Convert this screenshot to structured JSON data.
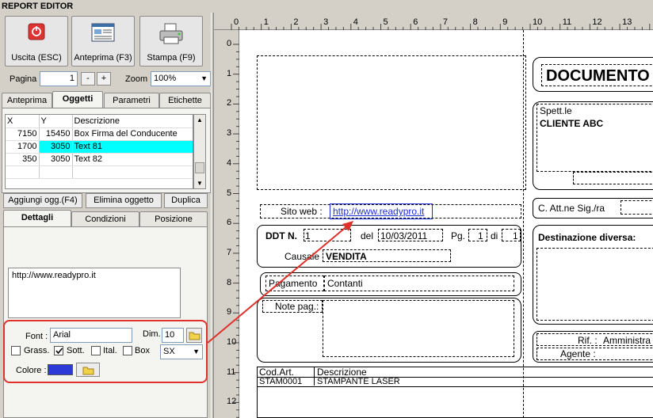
{
  "window": {
    "title": "REPORT EDITOR"
  },
  "toolbar": {
    "exit_label": "Uscita (ESC)",
    "preview_label": "Anteprima (F3)",
    "print_label": "Stampa (F9)"
  },
  "nav": {
    "page_label": "Pagina",
    "page_value": "1",
    "minus": "-",
    "plus": "+",
    "zoom_label": "Zoom",
    "zoom_value": "100%"
  },
  "tabs_top": [
    "Anteprima",
    "Oggetti",
    "Parametri",
    "Etichette"
  ],
  "objects_table": {
    "headers": [
      "X",
      "Y",
      "Descrizione"
    ],
    "rows": [
      [
        "7150",
        "15450",
        "Box Firma del Conducente"
      ],
      [
        "1700",
        "3050",
        "Text 81"
      ],
      [
        "350",
        "3050",
        "Text 82"
      ]
    ]
  },
  "actions": {
    "add_label": "Aggiungi ogg.(F4)",
    "delete_label": "Elimina oggetto",
    "duplicate_label": "Duplica"
  },
  "tabs_details": [
    "Dettagli",
    "Condizioni",
    "Posizione"
  ],
  "details": {
    "text_value": "http://www.readypro.it",
    "font_label": "Font :",
    "font_value": "Arial",
    "dim_label": "Dim.",
    "dim_value": "10",
    "bold_label": "Grass.",
    "underline_label": "Sott.",
    "italic_label": "Ital.",
    "box_label": "Box",
    "align_value": "SX",
    "color_label": "Colore :",
    "color_value": "#2c3bd8"
  },
  "ruler": {
    "top": [
      "0",
      "1",
      "2",
      "3",
      "4",
      "5",
      "6",
      "7",
      "8",
      "9",
      "10",
      "11",
      "12",
      "13"
    ],
    "left": [
      "0",
      "1",
      "2",
      "3",
      "4",
      "5",
      "6",
      "7",
      "8",
      "9",
      "10",
      "11",
      "12"
    ]
  },
  "report": {
    "doc_title": "DOCUMENTO",
    "spett_label": "Spett.le",
    "client_name": "CLIENTE ABC",
    "sito_label": "Sito web :",
    "sito_value": "http://www.readypro.it",
    "att_label": "C. Att.ne Sig./ra",
    "ddt_label": "DDT N.",
    "ddt_number": "1",
    "del_label": "del",
    "ddt_date": "10/03/2011",
    "pg_label": "Pg.",
    "pg_num": "1",
    "di_label": "di",
    "pg_total": "1",
    "causale_label": "Causale",
    "causale_value": "VENDITA",
    "dest_label": "Destinazione diversa:",
    "pagamento_label": "Pagamento",
    "pagamento_value": "Contanti",
    "note_label": "Note pag.:",
    "rif_label": "Rif. :",
    "rif_value": "Amministra",
    "agente_label": "Agente :",
    "col_code": "Cod.Art.",
    "col_desc": "Descrizione",
    "row_code": "STAM0001",
    "row_desc": "STAMPANTE LASER"
  },
  "colors": {
    "highlight_row": "#00ffff",
    "annotation": "#e0302a",
    "link": "#1f2fd6"
  }
}
